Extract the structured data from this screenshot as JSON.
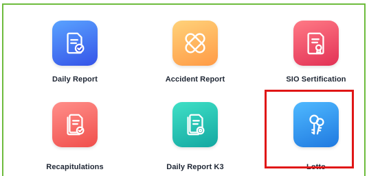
{
  "menu": {
    "items": [
      {
        "label": "Daily Report",
        "icon": "document-check-icon",
        "color": "#3553e8"
      },
      {
        "label": "Accident Report",
        "icon": "bandage-icon",
        "color": "#ff9a45"
      },
      {
        "label": "SIO Sertification",
        "icon": "certificate-icon",
        "color": "#e23155"
      },
      {
        "label": "Recapitulations",
        "icon": "documents-stack-icon",
        "color": "#f04e4b"
      },
      {
        "label": "Daily Report K3",
        "icon": "document-gear-icon",
        "color": "#13a7a1"
      },
      {
        "label": "Lotto",
        "icon": "keys-icon",
        "color": "#1f79e0"
      }
    ],
    "highlighted": "Lotto",
    "highlight_color": "#e01616",
    "frame_color": "#6dbb3c"
  }
}
